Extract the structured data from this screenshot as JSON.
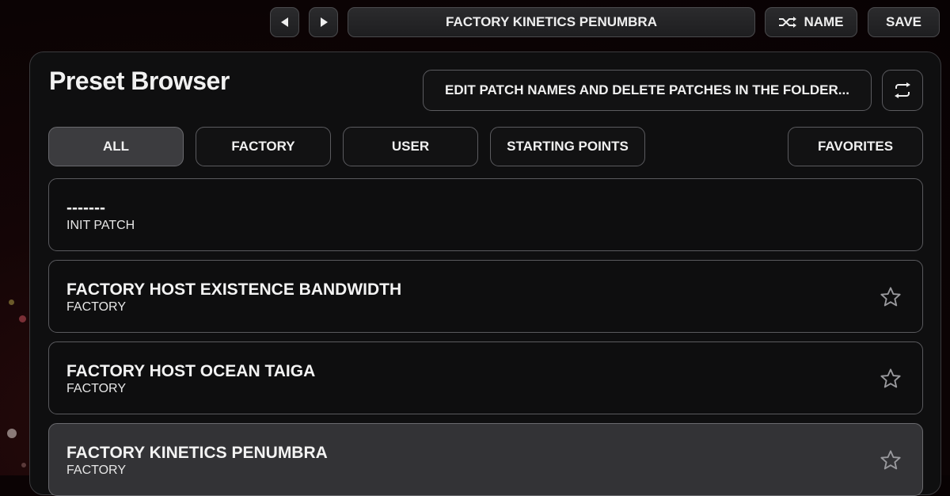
{
  "topbar": {
    "prev_icon": "triangle-left-icon",
    "next_icon": "triangle-right-icon",
    "preset_name": "FACTORY KINETICS PENUMBRA",
    "name_icon": "shuffle-icon",
    "name_label": "NAME",
    "save_label": "SAVE"
  },
  "browser": {
    "title": "Preset Browser",
    "edit_folder_label": "EDIT PATCH NAMES AND DELETE PATCHES IN THE FOLDER...",
    "refresh_icon": "refresh-icon",
    "filters": {
      "all": "ALL",
      "factory": "FACTORY",
      "user": "USER",
      "starting_points": "STARTING POINTS",
      "favorites": "FAVORITES"
    },
    "active_filter": "all",
    "presets": [
      {
        "name": "-------",
        "category": "INIT PATCH",
        "favorite_icon": ""
      },
      {
        "name": "FACTORY HOST EXISTENCE BANDWIDTH",
        "category": "FACTORY",
        "favorite_icon": "star-outline-icon"
      },
      {
        "name": "FACTORY HOST OCEAN TAIGA",
        "category": "FACTORY",
        "favorite_icon": "star-outline-icon"
      },
      {
        "name": "FACTORY KINETICS PENUMBRA",
        "category": "FACTORY",
        "favorite_icon": "star-outline-icon",
        "selected": true
      }
    ]
  },
  "colors": {
    "background": "#0b0304",
    "panel": "#0f0f10",
    "active_pill": "#3c3c3f",
    "border": "#5a5a5e",
    "text": "#f2f2f2"
  }
}
